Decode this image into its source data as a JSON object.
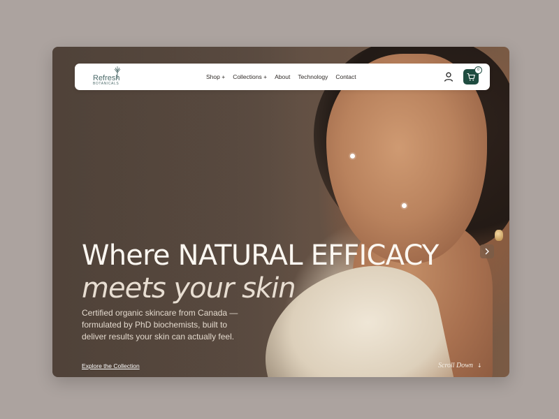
{
  "brand": {
    "name": "Refresh",
    "tagline": "BOTANICALS"
  },
  "nav": {
    "items": [
      {
        "label": "Shop +"
      },
      {
        "label": "Collections +"
      },
      {
        "label": "About"
      },
      {
        "label": "Technology"
      },
      {
        "label": "Contact"
      }
    ],
    "cart_count": "0"
  },
  "hero": {
    "headline": "Where NATURAL EFFICACY",
    "headline_italic": "meets your skin",
    "subcopy": [
      "Certified organic skincare from Canada —",
      "formulated by PhD biochemists, built to",
      "deliver results your skin can actually feel."
    ],
    "cta_label": "Explore the Collection",
    "scroll_label": "Scroll Down",
    "scroll_arrow": "↓"
  },
  "colors": {
    "page_background": "#aca39f",
    "nav_background": "#ffffff",
    "accent_green": "#1f4c40",
    "logo_teal": "#4c6b6a",
    "headline": "#fbf7f1"
  },
  "icons": {
    "user": "user-icon",
    "cart": "cart-icon",
    "next": "chevron-right-icon",
    "logo": "botanical-sprig-icon"
  }
}
